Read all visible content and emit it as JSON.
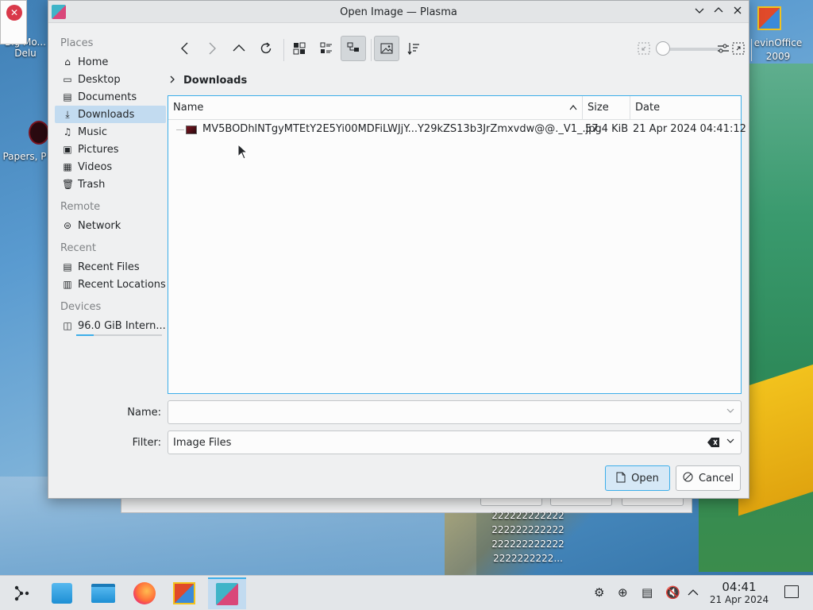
{
  "desktop": {
    "icons": [
      {
        "label": "Big Mo... Delu"
      },
      {
        "label": "Papers, P"
      },
      {
        "label": "evinOffice 2009"
      }
    ],
    "bg_text": [
      "222222222222",
      "222222222222",
      "222222222222",
      "2222222222..."
    ]
  },
  "dialog": {
    "title": "Open Image — Plasma",
    "places": {
      "sections": [
        {
          "title": "Places",
          "items": [
            {
              "label": "Home",
              "icon": "home-icon"
            },
            {
              "label": "Desktop",
              "icon": "desktop-icon"
            },
            {
              "label": "Documents",
              "icon": "documents-icon"
            },
            {
              "label": "Downloads",
              "icon": "downloads-icon",
              "active": true
            },
            {
              "label": "Music",
              "icon": "music-icon"
            },
            {
              "label": "Pictures",
              "icon": "pictures-icon"
            },
            {
              "label": "Videos",
              "icon": "videos-icon"
            },
            {
              "label": "Trash",
              "icon": "trash-icon"
            }
          ]
        },
        {
          "title": "Remote",
          "items": [
            {
              "label": "Network",
              "icon": "network-icon"
            }
          ]
        },
        {
          "title": "Recent",
          "items": [
            {
              "label": "Recent Files",
              "icon": "recent-files-icon"
            },
            {
              "label": "Recent Locations",
              "icon": "recent-locations-icon"
            }
          ]
        },
        {
          "title": "Devices",
          "items": [
            {
              "label": "96.0 GiB Intern...",
              "icon": "drive-icon",
              "usage_fraction": 0.2
            }
          ]
        }
      ]
    },
    "breadcrumb": "Downloads",
    "columns": {
      "name": "Name",
      "size": "Size",
      "date": "Date"
    },
    "files": [
      {
        "name": "MV5BODhlNTgyMTEtY2E5Yi00MDFiLWJjY...Y29kZS13b3JrZmxvdw@@._V1_.jpg",
        "size": "57.4 KiB",
        "date": "21 Apr 2024 04:41:12"
      }
    ],
    "name_label": "Name:",
    "name_value": "",
    "filter_label": "Filter:",
    "filter_value": "Image Files",
    "open_label": "Open",
    "cancel_label": "Cancel"
  },
  "clock": {
    "time": "04:41",
    "date": "21 Apr 2024"
  },
  "colors": {
    "accent": "#3daee9",
    "selection": "#c2dbf0"
  }
}
